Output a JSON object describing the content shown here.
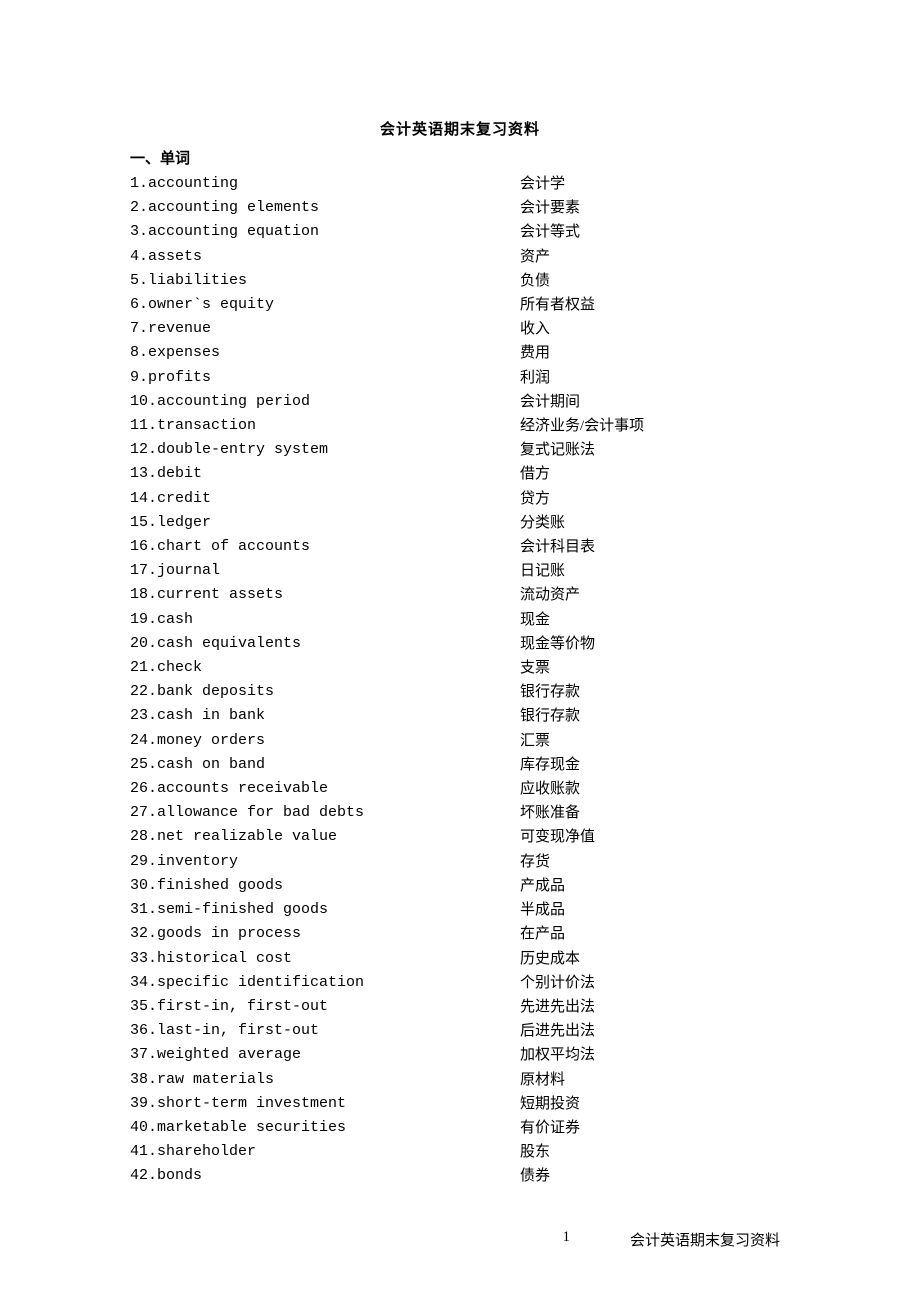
{
  "title": "会计英语期末复习资料",
  "section_heading": "一、单词",
  "vocab": [
    {
      "n": "1.",
      "en": "accounting",
      "zh": "会计学"
    },
    {
      "n": "2.",
      "en": "accounting elements",
      "zh": "会计要素"
    },
    {
      "n": "3.",
      "en": "accounting equation",
      "zh": "会计等式"
    },
    {
      "n": "4.",
      "en": "assets",
      "zh": "资产"
    },
    {
      "n": "5.",
      "en": "liabilities",
      "zh": "负债"
    },
    {
      "n": "6.",
      "en": "owner`s equity",
      "zh": "所有者权益"
    },
    {
      "n": "7.",
      "en": "revenue",
      "zh": "收入"
    },
    {
      "n": "8.",
      "en": "expenses",
      "zh": "费用"
    },
    {
      "n": "9.",
      "en": "profits",
      "zh": "利润"
    },
    {
      "n": "10.",
      "en": "accounting period",
      "zh": "会计期间"
    },
    {
      "n": "11.",
      "en": "transaction",
      "zh": "经济业务/会计事项"
    },
    {
      "n": "12.",
      "en": "double-entry system",
      "zh": "复式记账法"
    },
    {
      "n": "13.",
      "en": "debit",
      "zh": "借方"
    },
    {
      "n": "14.",
      "en": "credit",
      "zh": "贷方"
    },
    {
      "n": "15.",
      "en": "ledger",
      "zh": "分类账"
    },
    {
      "n": "16.",
      "en": "chart of accounts",
      "zh": "会计科目表"
    },
    {
      "n": "17.",
      "en": "journal",
      "zh": "日记账"
    },
    {
      "n": "18.",
      "en": "current assets",
      "zh": "流动资产"
    },
    {
      "n": "19.",
      "en": "cash",
      "zh": "现金"
    },
    {
      "n": "20.",
      "en": "cash equivalents",
      "zh": "现金等价物"
    },
    {
      "n": "21.",
      "en": "check",
      "zh": "支票"
    },
    {
      "n": "22.",
      "en": "bank deposits",
      "zh": "银行存款"
    },
    {
      "n": "23.",
      "en": "cash in bank",
      "zh": "银行存款"
    },
    {
      "n": "24.",
      "en": "money orders",
      "zh": "汇票"
    },
    {
      "n": "25.",
      "en": "cash on band",
      "zh": "库存现金"
    },
    {
      "n": "26.",
      "en": "accounts receivable",
      "zh": "应收账款"
    },
    {
      "n": "27.",
      "en": "allowance for bad debts",
      "zh": "坏账准备"
    },
    {
      "n": "28.",
      "en": "net realizable value",
      "zh": "可变现净值"
    },
    {
      "n": "29.",
      "en": "inventory",
      "zh": "存货"
    },
    {
      "n": "30.",
      "en": "finished goods",
      "zh": "产成品"
    },
    {
      "n": "31.",
      "en": "semi-finished goods",
      "zh": "半成品"
    },
    {
      "n": "32.",
      "en": "goods in process",
      "zh": "在产品"
    },
    {
      "n": "33.",
      "en": "historical cost",
      "zh": "历史成本"
    },
    {
      "n": "34.",
      "en": "specific identification",
      "zh": "个别计价法"
    },
    {
      "n": "35.",
      "en": "first-in, first-out",
      "zh": "先进先出法"
    },
    {
      "n": "36.",
      "en": "last-in, first-out",
      "zh": "后进先出法"
    },
    {
      "n": "37.",
      "en": "weighted average",
      "zh": "加权平均法"
    },
    {
      "n": "38.",
      "en": "raw materials",
      "zh": "原材料"
    },
    {
      "n": "39.",
      "en": "short-term investment",
      "zh": "短期投资"
    },
    {
      "n": "40.",
      "en": "marketable securities",
      "zh": "有价证券"
    },
    {
      "n": "41.",
      "en": "shareholder",
      "zh": "股东"
    },
    {
      "n": "42.",
      "en": "bonds",
      "zh": "债券"
    }
  ],
  "footer": {
    "page_number": "1",
    "label": "会计英语期末复习资料"
  }
}
